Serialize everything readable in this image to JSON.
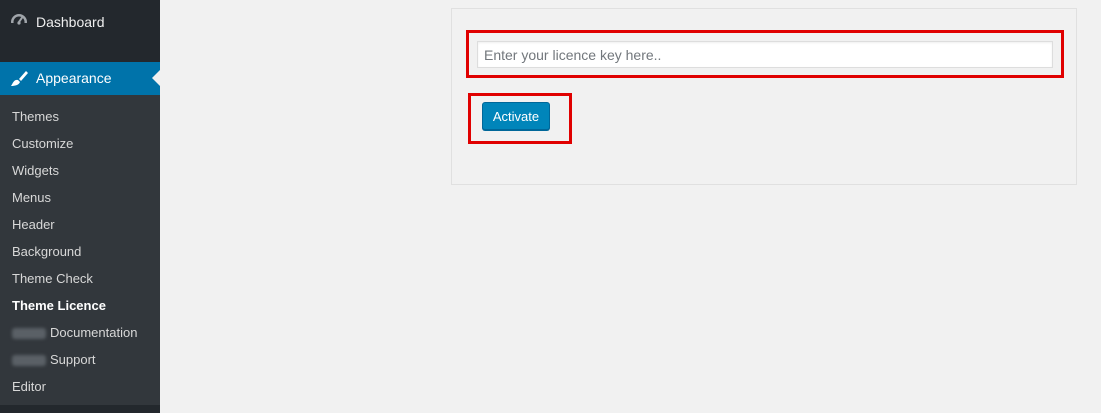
{
  "sidebar": {
    "dashboard": {
      "label": "Dashboard",
      "icon": "dashboard-icon"
    },
    "appearance": {
      "label": "Appearance",
      "icon": "paintbrush-icon"
    },
    "submenu": [
      {
        "label": "Themes"
      },
      {
        "label": "Customize"
      },
      {
        "label": "Widgets"
      },
      {
        "label": "Menus"
      },
      {
        "label": "Header"
      },
      {
        "label": "Background"
      },
      {
        "label": "Theme Check"
      },
      {
        "label": "Theme Licence",
        "current": true
      },
      {
        "label": "Documentation"
      },
      {
        "label": "Support"
      },
      {
        "label": "Editor"
      }
    ]
  },
  "licence_form": {
    "placeholder": "Enter your licence key here..",
    "value": "",
    "activate_label": "Activate"
  },
  "colors": {
    "sidebar_bg": "#32373c",
    "accent": "#0073aa",
    "button": "#0085ba",
    "highlight": "#e00000"
  }
}
